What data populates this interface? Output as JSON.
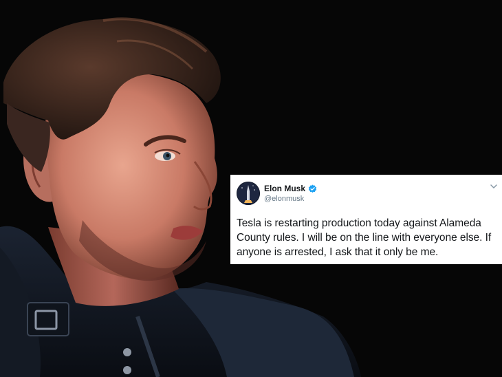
{
  "photo": {
    "subject_icon": "portrait-photo",
    "background_color": "#060606"
  },
  "tweet": {
    "avatar_icon": "avatar-icon",
    "display_name": "Elon Musk",
    "verified_icon": "verified-badge-icon",
    "verified_color": "#1da1f2",
    "handle": "@elonmusk",
    "menu_icon": "chevron-down-icon",
    "text": "Tesla is restarting production today against Alameda County rules. I will be on the line with everyone else. If anyone is arrested, I ask that it only be me."
  }
}
